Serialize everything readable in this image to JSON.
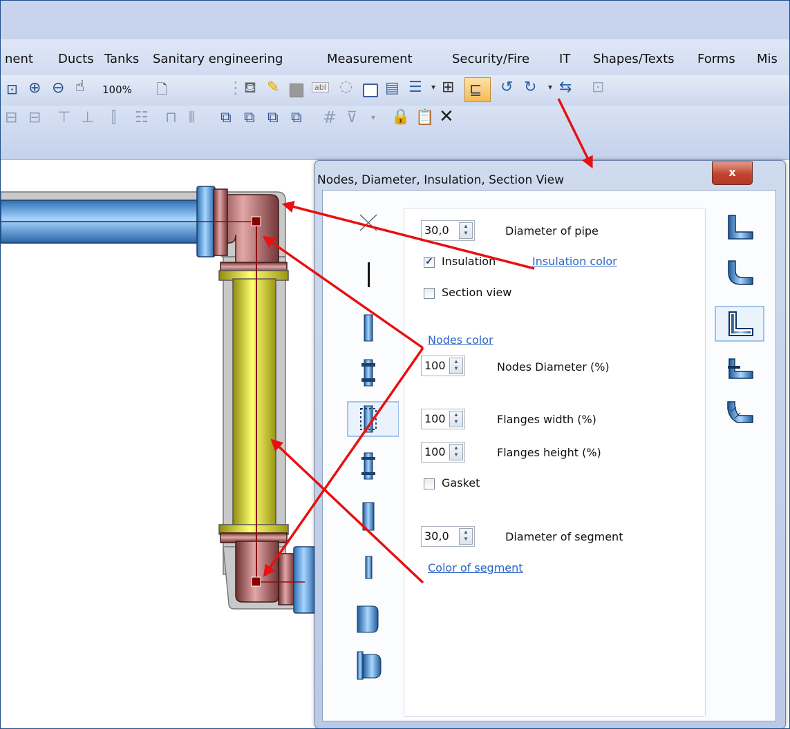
{
  "menu": {
    "items": [
      "nent",
      "Ducts",
      "Tanks",
      "Sanitary engineering",
      "Measurement",
      "Security/Fire",
      "IT",
      "Shapes/Texts",
      "Forms",
      "Mis"
    ]
  },
  "toolbar": {
    "zoom_label": "100%",
    "text_field_label": "abl"
  },
  "dialog": {
    "title": "Nodes, Diameter, Insulation, Section View",
    "close_label": "x",
    "pipe_diameter_value": "30,0",
    "pipe_diameter_label": "Diameter of pipe",
    "insulation_label": "Insulation",
    "insulation_checked": true,
    "insulation_color_link": "Insulation color",
    "section_view_label": "Section view",
    "section_view_checked": false,
    "nodes_color_link": "Nodes color",
    "nodes_diameter_value": "100",
    "nodes_diameter_label": "Nodes Diameter (%)",
    "flanges_width_value": "100",
    "flanges_width_label": "Flanges width (%)",
    "flanges_height_value": "100",
    "flanges_height_label": "Flanges height (%)",
    "gasket_label": "Gasket",
    "gasket_checked": false,
    "segment_diameter_value": "30,0",
    "segment_diameter_label": "Diameter of segment",
    "segment_color_link": "Color of segment"
  },
  "icons": {
    "node_styles": [
      "none-node-icon",
      "line-node-icon",
      "plain-node-icon",
      "flange-node-icon",
      "bolted-flange-node-icon",
      "double-flange-node-icon",
      "sleeve-node-icon",
      "thin-sleeve-node-icon",
      "end-cap-node-icon",
      "flanged-end-cap-node-icon"
    ],
    "elbow_styles": [
      "square-elbow-icon",
      "round-elbow-icon",
      "sharp-elbow-icon",
      "flanged-elbow-icon",
      "segmented-elbow-icon"
    ]
  },
  "colors": {
    "pipe_blue": "#5ea9e6",
    "elbow_red": "#b06a6a",
    "segment_yellow": "#f6f23a",
    "annotation_red": "#e81010"
  }
}
